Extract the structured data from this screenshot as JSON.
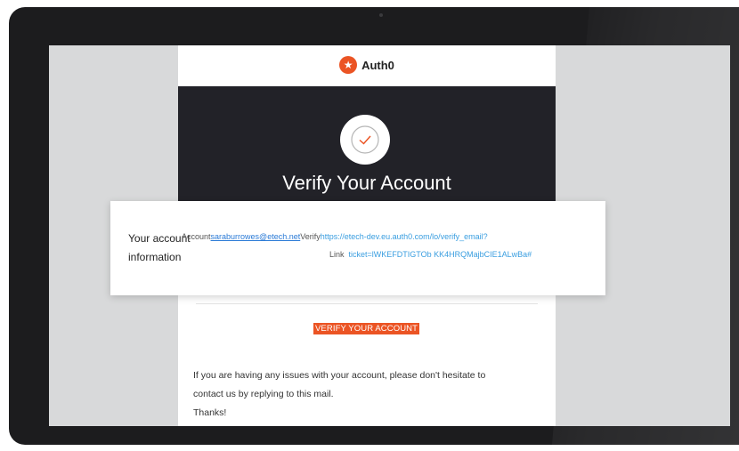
{
  "logo": {
    "text": "Auth0"
  },
  "hero": {
    "title": "Verify Your Account"
  },
  "info": {
    "label": "Your account information",
    "account_label": "Account",
    "email": "saraburrowes@etech.net",
    "verify_label": "Verify",
    "verify_link_part1": "https://etech-dev.eu.auth0.com/lo/verify_email?",
    "link_label": "Link",
    "verify_link_part2": "ticket=lWKEFDTIGTOb KK4HRQMajbCIE1ALwBa#"
  },
  "cta": {
    "label": "VERIFY YOUR ACCOUNT"
  },
  "body": {
    "line1": "If you are having any issues with your account, please don't hesitate to",
    "line2": "contact us by replying to this mail.",
    "line3": "Thanks!"
  },
  "colors": {
    "brand": "#eb5424",
    "hero_bg": "#222228",
    "link": "#2a7ad6"
  },
  "icons": {
    "logo": "auth0-star-logo",
    "check": "check-circle-icon"
  }
}
